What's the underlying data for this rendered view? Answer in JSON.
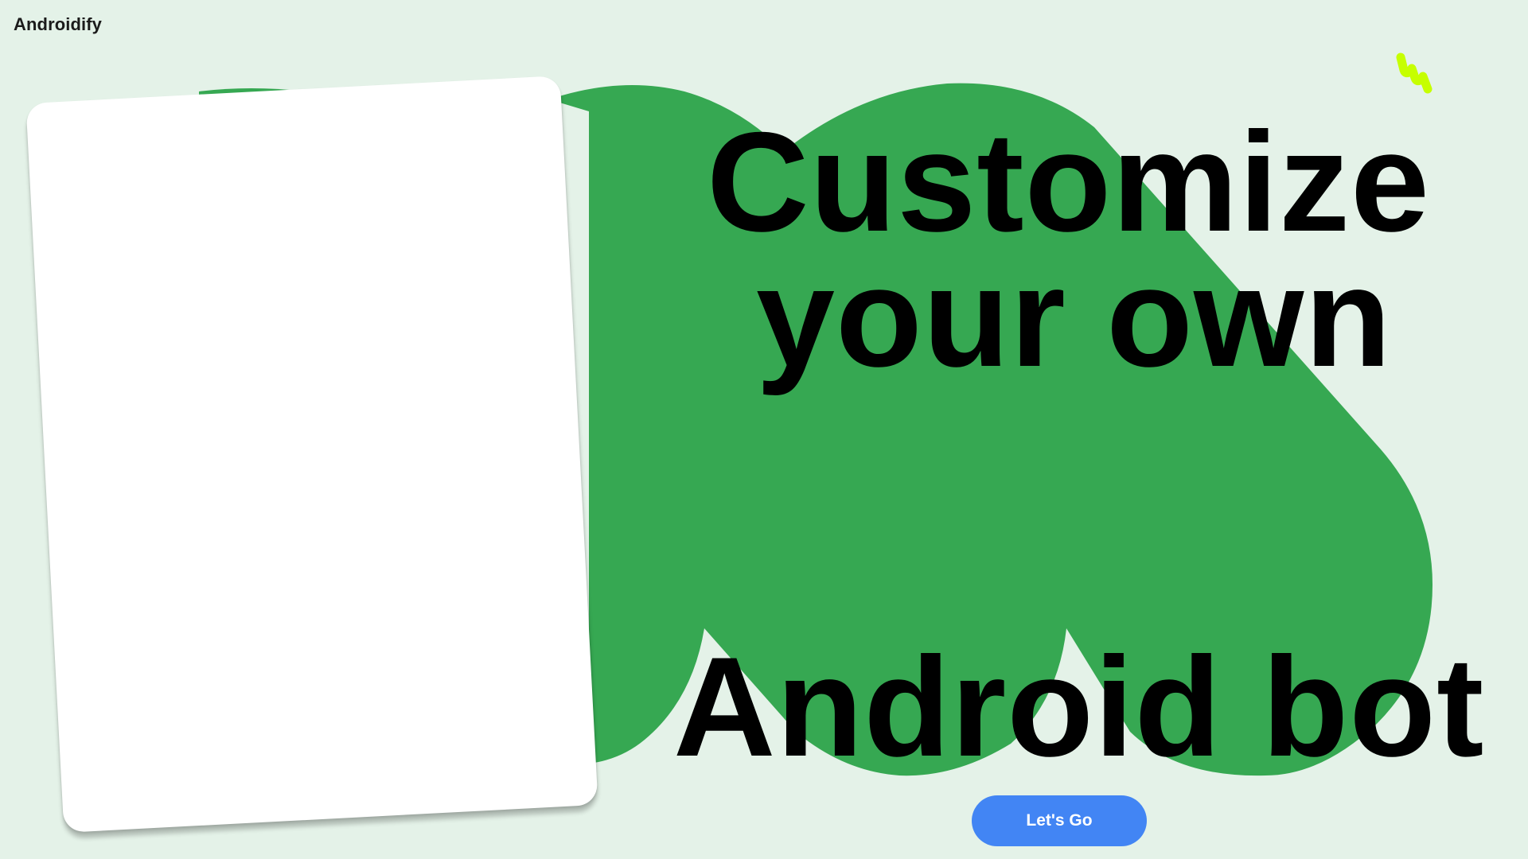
{
  "app": {
    "title": "Androidify"
  },
  "hero": {
    "line1": "Customize",
    "line2": "your own",
    "line3": "Android bot"
  },
  "actions": {
    "cta_label": "Let's Go"
  },
  "theme": {
    "background": "#e4f2e8",
    "shape_green": "#36a852",
    "card": "#ffffff",
    "button": "#4285f4",
    "sparkle": "#c6ff00"
  },
  "icons": {
    "sparkle": "squiggle-sparkle-icon"
  }
}
